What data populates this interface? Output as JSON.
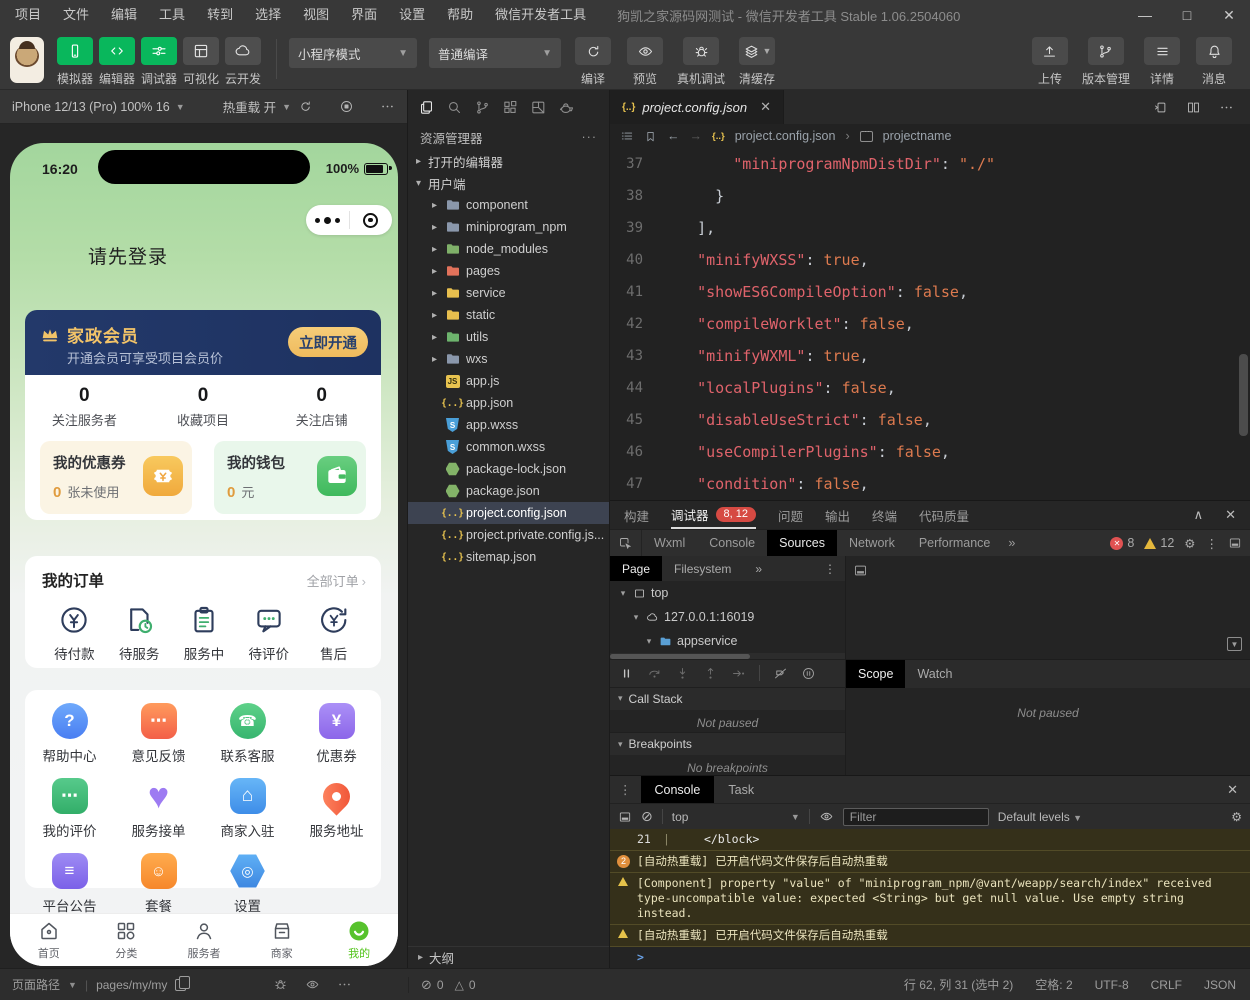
{
  "titlebar": {
    "menus": [
      "项目",
      "文件",
      "编辑",
      "工具",
      "转到",
      "选择",
      "视图",
      "界面",
      "设置",
      "帮助",
      "微信开发者工具"
    ],
    "title": "狗凯之家源码网测试 - 微信开发者工具 Stable 1.06.2504060",
    "window_controls": [
      "—",
      "□",
      "✕"
    ]
  },
  "toolbar": {
    "mode_buttons": [
      {
        "label": "模拟器",
        "icon": "phone",
        "style": "green"
      },
      {
        "label": "编辑器",
        "icon": "codetag",
        "style": "green"
      },
      {
        "label": "调试器",
        "icon": "tune",
        "style": "green"
      },
      {
        "label": "可视化",
        "icon": "vis",
        "style": "gray"
      },
      {
        "label": "云开发",
        "icon": "cloud",
        "style": "gray"
      }
    ],
    "mode_select": "小程序模式",
    "compile_select": "普通编译",
    "actions": [
      {
        "label": "编译",
        "icon": "refresh"
      },
      {
        "label": "预览",
        "icon": "eye"
      },
      {
        "label": "真机调试",
        "icon": "bug"
      },
      {
        "label": "清缓存",
        "icon": "layers",
        "caret": true
      }
    ],
    "right_actions": [
      {
        "label": "上传",
        "icon": "upload"
      },
      {
        "label": "版本管理",
        "icon": "branch"
      },
      {
        "label": "详情",
        "icon": "lines"
      },
      {
        "label": "消息",
        "icon": "bell"
      }
    ]
  },
  "simulator_bar": {
    "device": "iPhone 12/13 (Pro) 100% 16",
    "hot_reload": "热重载 开"
  },
  "phone": {
    "time": "16:20",
    "battery": "100%",
    "login_prompt": "请先登录",
    "member": {
      "title": "家政会员",
      "subtitle": "开通会员可享受项目会员价",
      "button": "立即开通"
    },
    "stats": [
      {
        "value": "0",
        "label": "关注服务者"
      },
      {
        "value": "0",
        "label": "收藏项目"
      },
      {
        "value": "0",
        "label": "关注店铺"
      }
    ],
    "purses": [
      {
        "title": "我的优惠券",
        "value": "0",
        "unit": "张未使用",
        "icon": "coupon",
        "theme": "cream"
      },
      {
        "title": "我的钱包",
        "value": "0",
        "unit": "元",
        "icon": "wallet",
        "theme": "greenish"
      }
    ],
    "orders": {
      "title": "我的订单",
      "more": "全部订单",
      "items": [
        {
          "label": "待付款",
          "icon": "pay"
        },
        {
          "label": "待服务",
          "icon": "serve"
        },
        {
          "label": "服务中",
          "icon": "serving"
        },
        {
          "label": "待评价",
          "icon": "review"
        },
        {
          "label": "售后",
          "icon": "after"
        }
      ]
    },
    "grid": [
      {
        "label": "帮助中心",
        "kind": "help"
      },
      {
        "label": "意见反馈",
        "kind": "feedback"
      },
      {
        "label": "联系客服",
        "kind": "contact"
      },
      {
        "label": "优惠券",
        "kind": "coupon2"
      },
      {
        "label": "我的评价",
        "kind": "reviews"
      },
      {
        "label": "服务接单",
        "kind": "orders2"
      },
      {
        "label": "商家入驻",
        "kind": "merchant"
      },
      {
        "label": "服务地址",
        "kind": "address"
      },
      {
        "label": "平台公告",
        "kind": "notice"
      },
      {
        "label": "套餐",
        "kind": "package"
      },
      {
        "label": "设置",
        "kind": "settings"
      }
    ],
    "tabbar": [
      {
        "label": "首页",
        "icon": "home"
      },
      {
        "label": "分类",
        "icon": "gridic"
      },
      {
        "label": "服务者",
        "icon": "person"
      },
      {
        "label": "商家",
        "icon": "storeic"
      },
      {
        "label": "我的",
        "icon": "smile",
        "active": true
      }
    ]
  },
  "page_path_bar": {
    "label": "页面路径",
    "path": "pages/my/my"
  },
  "explorer": {
    "title": "资源管理器",
    "outline": "大纲",
    "problems": {
      "errors": "0",
      "warnings": "0"
    },
    "tree": [
      {
        "label": "打开的编辑器",
        "indent": 0,
        "chev": "▸"
      },
      {
        "label": "用户端",
        "indent": 0,
        "chev": "▾"
      },
      {
        "label": "component",
        "indent": 1,
        "chev": "▸",
        "icon": "folder",
        "color": "#8a97ab"
      },
      {
        "label": "miniprogram_npm",
        "indent": 1,
        "chev": "▸",
        "icon": "folder",
        "color": "#8a97ab"
      },
      {
        "label": "node_modules",
        "indent": 1,
        "chev": "▸",
        "icon": "folder",
        "color": "#7fb069"
      },
      {
        "label": "pages",
        "indent": 1,
        "chev": "▸",
        "icon": "folder",
        "color": "#e2725b"
      },
      {
        "label": "service",
        "indent": 1,
        "chev": "▸",
        "icon": "folder",
        "color": "#e8bf4e"
      },
      {
        "label": "static",
        "indent": 1,
        "chev": "▸",
        "icon": "folder",
        "color": "#e8bf4e"
      },
      {
        "label": "utils",
        "indent": 1,
        "chev": "▸",
        "icon": "folder",
        "color": "#6db36d"
      },
      {
        "label": "wxs",
        "indent": 1,
        "chev": "▸",
        "icon": "folder",
        "color": "#8a97ab"
      },
      {
        "label": "app.js",
        "indent": 1,
        "icon": "js"
      },
      {
        "label": "app.json",
        "indent": 1,
        "icon": "braces"
      },
      {
        "label": "app.wxss",
        "indent": 1,
        "icon": "wxss"
      },
      {
        "label": "common.wxss",
        "indent": 1,
        "icon": "wxss"
      },
      {
        "label": "package-lock.json",
        "indent": 1,
        "icon": "npm"
      },
      {
        "label": "package.json",
        "indent": 1,
        "icon": "npm"
      },
      {
        "label": "project.config.json",
        "indent": 1,
        "icon": "braces",
        "selected": true
      },
      {
        "label": "project.private.config.js...",
        "indent": 1,
        "icon": "braces"
      },
      {
        "label": "sitemap.json",
        "indent": 1,
        "icon": "braces"
      }
    ]
  },
  "editor": {
    "tab": "project.config.json",
    "breadcrumb": [
      "project.config.json",
      "projectname"
    ],
    "lines": [
      {
        "n": "37",
        "ind": 3,
        "toks": [
          {
            "c": "k",
            "t": "\"miniprogramNpmDistDir\""
          },
          {
            "c": "p",
            "t": ": "
          },
          {
            "c": "s",
            "t": "\"./\""
          }
        ]
      },
      {
        "n": "38",
        "ind": 2,
        "toks": [
          {
            "c": "p",
            "t": "}"
          }
        ]
      },
      {
        "n": "39",
        "ind": 1,
        "toks": [
          {
            "c": "p",
            "t": "],"
          }
        ]
      },
      {
        "n": "40",
        "ind": 1,
        "toks": [
          {
            "c": "k",
            "t": "\"minifyWXSS\""
          },
          {
            "c": "p",
            "t": ": "
          },
          {
            "c": "b",
            "t": "true"
          },
          {
            "c": "p",
            "t": ","
          }
        ]
      },
      {
        "n": "41",
        "ind": 1,
        "toks": [
          {
            "c": "k",
            "t": "\"showES6CompileOption\""
          },
          {
            "c": "p",
            "t": ": "
          },
          {
            "c": "b",
            "t": "false"
          },
          {
            "c": "p",
            "t": ","
          }
        ]
      },
      {
        "n": "42",
        "ind": 1,
        "toks": [
          {
            "c": "k",
            "t": "\"compileWorklet\""
          },
          {
            "c": "p",
            "t": ": "
          },
          {
            "c": "b",
            "t": "false"
          },
          {
            "c": "p",
            "t": ","
          }
        ]
      },
      {
        "n": "43",
        "ind": 1,
        "toks": [
          {
            "c": "k",
            "t": "\"minifyWXML\""
          },
          {
            "c": "p",
            "t": ": "
          },
          {
            "c": "b",
            "t": "true"
          },
          {
            "c": "p",
            "t": ","
          }
        ]
      },
      {
        "n": "44",
        "ind": 1,
        "toks": [
          {
            "c": "k",
            "t": "\"localPlugins\""
          },
          {
            "c": "p",
            "t": ": "
          },
          {
            "c": "b",
            "t": "false"
          },
          {
            "c": "p",
            "t": ","
          }
        ]
      },
      {
        "n": "45",
        "ind": 1,
        "toks": [
          {
            "c": "k",
            "t": "\"disableUseStrict\""
          },
          {
            "c": "p",
            "t": ": "
          },
          {
            "c": "b",
            "t": "false"
          },
          {
            "c": "p",
            "t": ","
          }
        ]
      },
      {
        "n": "46",
        "ind": 1,
        "toks": [
          {
            "c": "k",
            "t": "\"useCompilerPlugins\""
          },
          {
            "c": "p",
            "t": ": "
          },
          {
            "c": "b",
            "t": "false"
          },
          {
            "c": "p",
            "t": ","
          }
        ]
      },
      {
        "n": "47",
        "ind": 1,
        "toks": [
          {
            "c": "k",
            "t": "\"condition\""
          },
          {
            "c": "p",
            "t": ": "
          },
          {
            "c": "b",
            "t": "false"
          },
          {
            "c": "p",
            "t": ","
          }
        ]
      }
    ]
  },
  "debugger": {
    "tabs": [
      "构建",
      "调试器",
      "问题",
      "输出",
      "终端",
      "代码质量"
    ],
    "active_tab": "调试器",
    "badge": "8, 12",
    "collapse": "∧",
    "close": "✕",
    "devtools_tabs": [
      "Wxml",
      "Console",
      "Sources",
      "Network",
      "Performance"
    ],
    "active_devtools_tab": "Sources",
    "errors": "8",
    "warnings": "12",
    "sources": {
      "tabs": [
        "Page",
        "Filesystem"
      ],
      "active": "Page",
      "tree": [
        {
          "label": "top",
          "icon": "frame",
          "indent": 0
        },
        {
          "label": "127.0.0.1:16019",
          "icon": "cloudsm",
          "indent": 1
        },
        {
          "label": "appservice",
          "icon": "bluefolder",
          "indent": 2
        }
      ],
      "call_stack": "Call Stack",
      "not_paused": "Not paused",
      "breakpoints": "Breakpoints",
      "no_breakpoints": "No breakpoints",
      "scope": "Scope",
      "watch": "Watch"
    }
  },
  "console": {
    "tabs": [
      "Console",
      "Task"
    ],
    "active_tab": "Console",
    "context": "top",
    "filter_placeholder": "Filter",
    "levels": "Default levels",
    "close": "✕",
    "messages": [
      {
        "type": "code",
        "num": "21",
        "text": "</block>"
      },
      {
        "type": "badge",
        "badge": "2",
        "text": "[自动热重载] 已开启代码文件保存后自动热重载"
      },
      {
        "type": "warn",
        "text": "[Component] property \"value\" of \"miniprogram_npm/@vant/weapp/search/index\" received type-uncompatible value: expected <String> but get null value. Use empty string instead."
      },
      {
        "type": "warn",
        "text": "[自动热重载] 已开启代码文件保存后自动热重载"
      }
    ],
    "prompt": ">"
  },
  "status_bar": {
    "line_col": "行 62, 列 31 (选中 2)",
    "spaces": "空格: 2",
    "encoding": "UTF-8",
    "eol": "CRLF",
    "lang": "JSON"
  },
  "colors": {
    "wechat_green": "#09b75c",
    "gold": "#f2c368",
    "navy": "#22386b",
    "warn_bg": "#35301a",
    "active_tab_green": "#52c41a"
  }
}
